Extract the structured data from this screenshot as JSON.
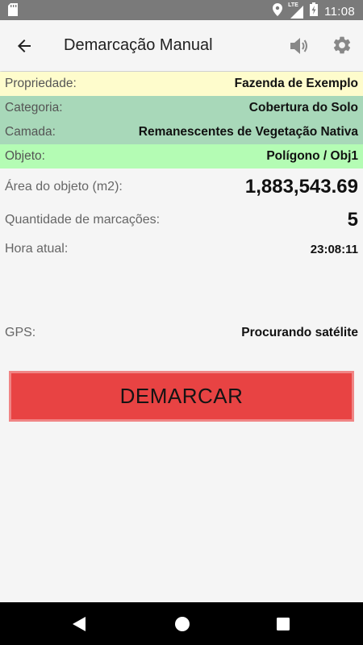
{
  "status_bar": {
    "time": "11:08",
    "network_label": "LTE",
    "icons": [
      "sd-card-icon",
      "location-icon",
      "signal-icon",
      "battery-charging-icon"
    ]
  },
  "app_bar": {
    "title": "Demarcação Manual",
    "icons": [
      "back-arrow-icon",
      "speaker-icon",
      "gear-icon"
    ]
  },
  "details": {
    "propriedade": {
      "label": "Propriedade:",
      "value": "Fazenda de Exemplo"
    },
    "categoria": {
      "label": "Categoria:",
      "value": "Cobertura do Solo"
    },
    "camada": {
      "label": "Camada:",
      "value": "Remanescentes de Vegetação Nativa"
    },
    "objeto": {
      "label": "Objeto:",
      "value": "Polígono / Obj1"
    }
  },
  "stats": {
    "area": {
      "label": "Área do objeto (m2):",
      "value": "1,883,543.69"
    },
    "quantidade": {
      "label": "Quantidade de marcações:",
      "value": "5"
    },
    "hora": {
      "label": "Hora atual:",
      "value": "23:08:11"
    },
    "gps": {
      "label": "GPS:",
      "value": "Procurando satélite"
    }
  },
  "action": {
    "demarcar_label": "DEMARCAR"
  },
  "colors": {
    "propriedade_bg": "#fefccc",
    "categoria_bg": "#a8d8b9",
    "objeto_bg": "#b4fcb4",
    "button_bg": "#e84343",
    "button_border": "#f08585"
  },
  "nav_bar": {
    "icons": [
      "nav-back-icon",
      "nav-home-icon",
      "nav-recents-icon"
    ]
  }
}
